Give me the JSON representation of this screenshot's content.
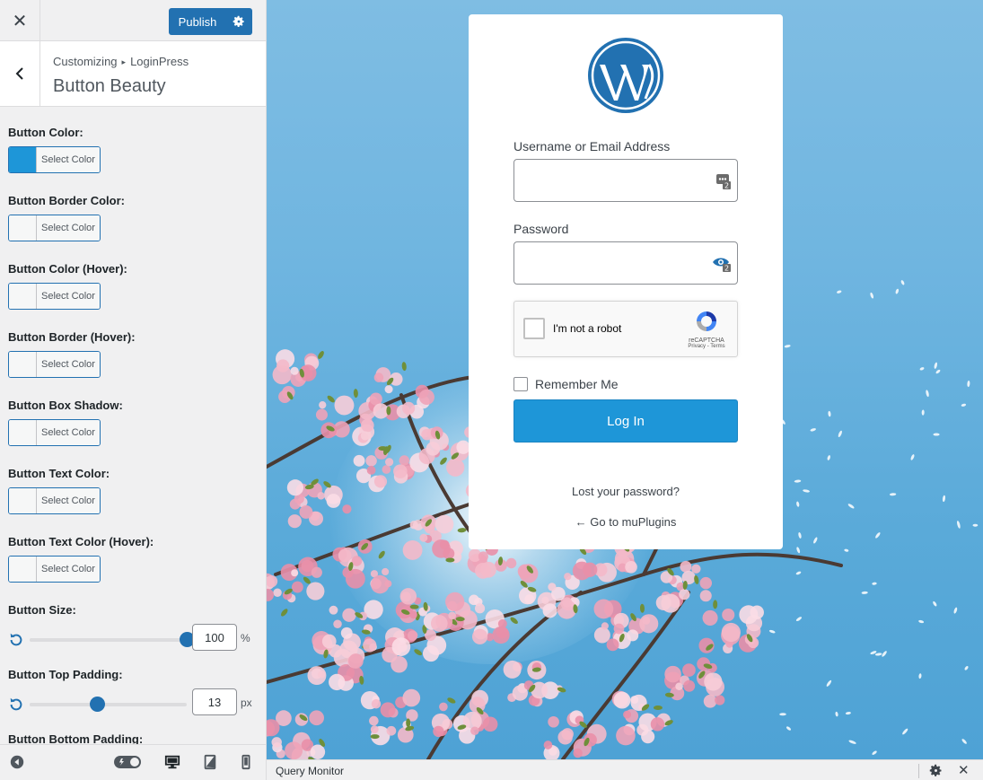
{
  "topbar": {
    "publish_label": "Publish"
  },
  "section": {
    "breadcrumb_root": "Customizing",
    "breadcrumb_parent": "LoginPress",
    "title": "Button Beauty"
  },
  "controls": {
    "color_pickers": [
      {
        "label": "Button Color:",
        "button_text": "Select Color",
        "color": "#1e96d8"
      },
      {
        "label": "Button Border Color:",
        "button_text": "Select Color",
        "color": "#f6f7f7"
      },
      {
        "label": "Button Color (Hover):",
        "button_text": "Select Color",
        "color": "#f6f7f7"
      },
      {
        "label": "Button Border (Hover):",
        "button_text": "Select Color",
        "color": "#f6f7f7"
      },
      {
        "label": "Button Box Shadow:",
        "button_text": "Select Color",
        "color": "#f6f7f7"
      },
      {
        "label": "Button Text Color:",
        "button_text": "Select Color",
        "color": "#f6f7f7"
      },
      {
        "label": "Button Text Color (Hover):",
        "button_text": "Select Color",
        "color": "#f6f7f7"
      }
    ],
    "sliders": [
      {
        "label": "Button Size:",
        "value": "100",
        "unit": "%",
        "fraction": 1.0
      },
      {
        "label": "Button Top Padding:",
        "value": "13",
        "unit": "px",
        "fraction": 0.43
      }
    ],
    "next_label": "Button Bottom Padding:"
  },
  "login": {
    "username_label": "Username or Email Address",
    "password_label": "Password",
    "captcha_text": "I'm not a robot",
    "captcha_brand": "reCAPTCHA",
    "captcha_links": "Privacy - Terms",
    "remember_label": "Remember Me",
    "login_button": "Log In",
    "lost_password": "Lost your password?",
    "back_link": "← Go to muPlugins"
  },
  "query_monitor": {
    "title": "Query Monitor"
  },
  "colors": {
    "accent": "#2271b1",
    "login_button": "#1e96d8",
    "wp_logo": "#2271b1"
  }
}
